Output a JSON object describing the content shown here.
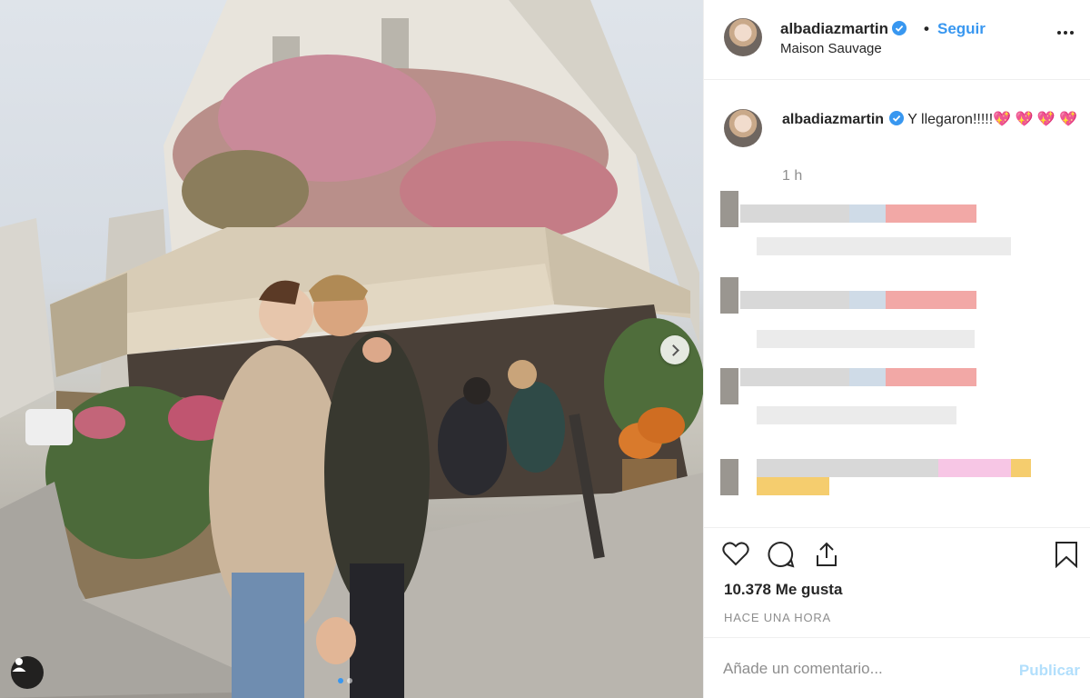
{
  "post": {
    "username": "albadiazmartin",
    "location": "Maison Sauvage",
    "follow_label": "Seguir",
    "bullet": "•",
    "caption": "Y llegaron!!!!!💖 💖 💖 💖",
    "time_ago": "1 h",
    "likes": "10.378 Me gusta",
    "posted_when": "HACE UNA HORA",
    "comment_placeholder": "Añade un comentario...",
    "publish_label": "Publicar"
  },
  "icons": {
    "verified": "verified-badge-icon",
    "more": "more-options-icon",
    "like": "heart-icon",
    "comment": "comment-bubble-icon",
    "share": "share-icon",
    "save": "bookmark-icon",
    "next": "chevron-right-icon",
    "tag": "user-tag-icon"
  },
  "carousel": {
    "current": 1,
    "total": 2
  },
  "colors": {
    "accent": "#3897f0",
    "publish_disabled": "#b2dffc",
    "text": "#262626",
    "muted": "#8e8e8e",
    "border": "#efefef"
  }
}
